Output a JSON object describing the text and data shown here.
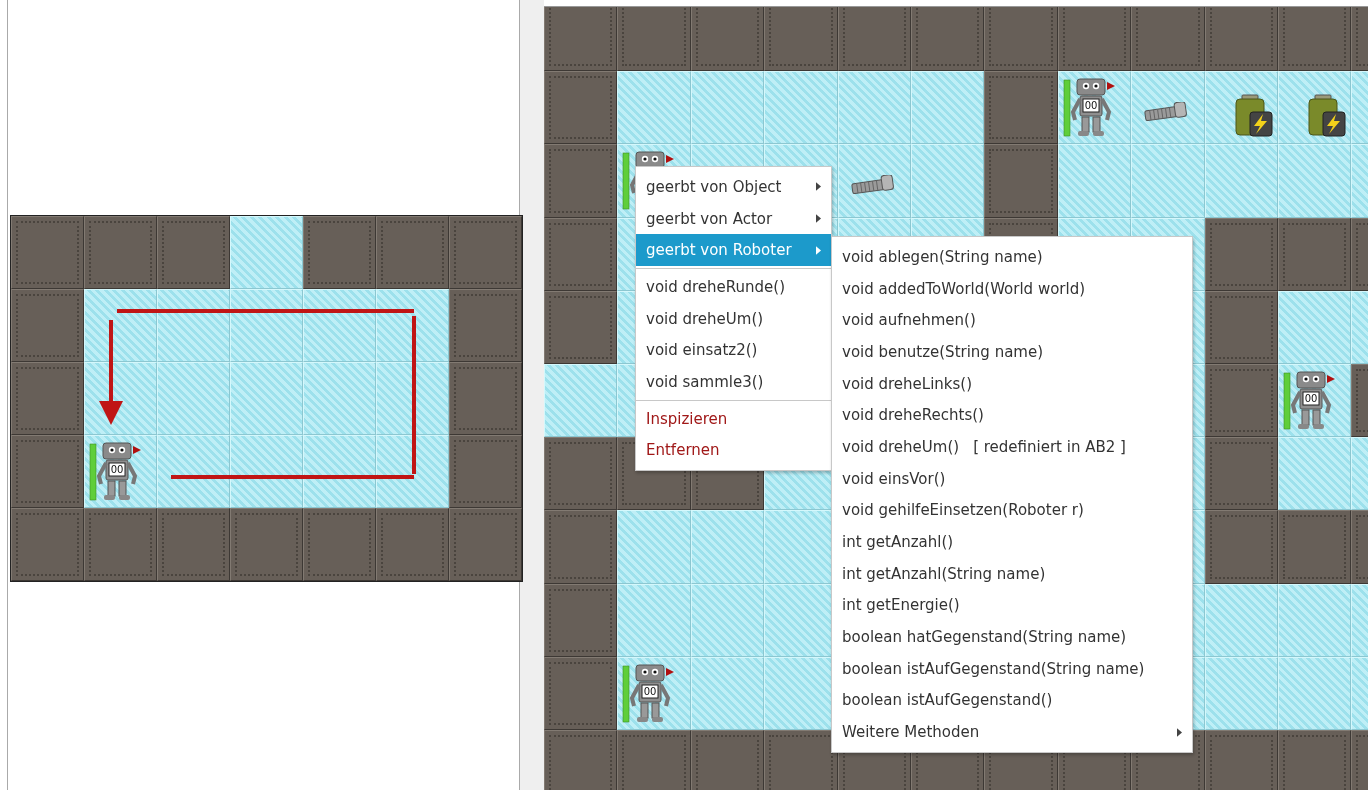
{
  "left_world": {
    "rows": [
      [
        {
          "kind": "wall"
        },
        {
          "kind": "wall"
        },
        {
          "kind": "wall"
        },
        {
          "kind": "floor"
        },
        {
          "kind": "wall"
        },
        {
          "kind": "wall"
        },
        {
          "kind": "wall"
        }
      ],
      [
        {
          "kind": "wall"
        },
        {
          "kind": "floor"
        },
        {
          "kind": "floor"
        },
        {
          "kind": "floor"
        },
        {
          "kind": "floor"
        },
        {
          "kind": "floor"
        },
        {
          "kind": "wall"
        }
      ],
      [
        {
          "kind": "wall"
        },
        {
          "kind": "floor"
        },
        {
          "kind": "floor"
        },
        {
          "kind": "floor"
        },
        {
          "kind": "floor"
        },
        {
          "kind": "floor"
        },
        {
          "kind": "wall"
        }
      ],
      [
        {
          "kind": "wall"
        },
        {
          "kind": "floor",
          "actor": {
            "kind": "robot",
            "counter": "00"
          }
        },
        {
          "kind": "floor"
        },
        {
          "kind": "floor"
        },
        {
          "kind": "floor"
        },
        {
          "kind": "floor"
        },
        {
          "kind": "wall"
        }
      ],
      [
        {
          "kind": "wall"
        },
        {
          "kind": "wall"
        },
        {
          "kind": "wall"
        },
        {
          "kind": "wall"
        },
        {
          "kind": "wall"
        },
        {
          "kind": "wall"
        },
        {
          "kind": "wall"
        }
      ]
    ]
  },
  "right_world": {
    "rows": [
      [
        {
          "kind": "wall"
        },
        {
          "kind": "wall"
        },
        {
          "kind": "wall"
        },
        {
          "kind": "wall"
        },
        {
          "kind": "wall"
        },
        {
          "kind": "wall"
        },
        {
          "kind": "wall"
        },
        {
          "kind": "wall"
        },
        {
          "kind": "wall"
        },
        {
          "kind": "wall"
        },
        {
          "kind": "wall"
        },
        {
          "kind": "wall"
        }
      ],
      [
        {
          "kind": "wall"
        },
        {
          "kind": "floor"
        },
        {
          "kind": "floor"
        },
        {
          "kind": "floor"
        },
        {
          "kind": "floor"
        },
        {
          "kind": "floor"
        },
        {
          "kind": "wall"
        },
        {
          "kind": "floor",
          "actor": {
            "kind": "robot",
            "counter": "00"
          }
        },
        {
          "kind": "floor",
          "actor": {
            "kind": "screw"
          }
        },
        {
          "kind": "floor",
          "actor": {
            "kind": "battery"
          }
        },
        {
          "kind": "floor",
          "actor": {
            "kind": "battery"
          }
        },
        {
          "kind": "floor"
        }
      ],
      [
        {
          "kind": "wall"
        },
        {
          "kind": "floor",
          "actor": {
            "kind": "robot"
          }
        },
        {
          "kind": "floor"
        },
        {
          "kind": "floor"
        },
        {
          "kind": "floor",
          "actor": {
            "kind": "screw"
          }
        },
        {
          "kind": "floor"
        },
        {
          "kind": "wall"
        },
        {
          "kind": "floor"
        },
        {
          "kind": "floor"
        },
        {
          "kind": "floor"
        },
        {
          "kind": "floor"
        },
        {
          "kind": "floor"
        }
      ],
      [
        {
          "kind": "wall"
        },
        {
          "kind": "floor"
        },
        {},
        {
          "kind": "floor"
        },
        {
          "kind": "floor"
        },
        {
          "kind": "floor"
        },
        {
          "kind": "wall"
        },
        {
          "kind": "floor"
        },
        {
          "kind": "floor"
        },
        {
          "kind": "wall"
        },
        {
          "kind": "wall"
        },
        {
          "kind": "wall"
        }
      ],
      [
        {
          "kind": "wall"
        },
        {
          "kind": "floor"
        },
        {},
        {},
        {},
        {},
        {},
        {},
        {
          "kind": "floor"
        },
        {
          "kind": "wall"
        },
        {
          "kind": "floor"
        },
        {
          "kind": "floor"
        }
      ],
      [
        {
          "kind": "floor"
        },
        {
          "kind": "floor"
        },
        {},
        {},
        {},
        {},
        {},
        {},
        {
          "kind": "floor"
        },
        {
          "kind": "wall"
        },
        {
          "kind": "floor",
          "actor": {
            "kind": "robot",
            "counter": "00"
          }
        },
        {
          "kind": "wall"
        }
      ],
      [
        {
          "kind": "wall"
        },
        {
          "kind": "wall"
        },
        {
          "kind": "wall"
        },
        {
          "kind": "floor"
        },
        {},
        {},
        {},
        {},
        {
          "kind": "floor"
        },
        {
          "kind": "wall"
        },
        {
          "kind": "floor"
        },
        {
          "kind": "floor"
        }
      ],
      [
        {
          "kind": "wall"
        },
        {
          "kind": "floor"
        },
        {
          "kind": "floor"
        },
        {
          "kind": "floor"
        },
        {},
        {},
        {},
        {},
        {
          "kind": "floor"
        },
        {
          "kind": "wall"
        },
        {
          "kind": "wall"
        },
        {
          "kind": "wall"
        }
      ],
      [
        {
          "kind": "wall"
        },
        {
          "kind": "floor"
        },
        {
          "kind": "floor"
        },
        {
          "kind": "floor"
        },
        {},
        {},
        {},
        {},
        {
          "kind": "floor"
        },
        {
          "kind": "floor"
        },
        {
          "kind": "floor"
        },
        {
          "kind": "floor"
        }
      ],
      [
        {
          "kind": "wall"
        },
        {
          "kind": "floor",
          "actor": {
            "kind": "robot",
            "counter": "00"
          }
        },
        {
          "kind": "floor"
        },
        {
          "kind": "floor"
        },
        {},
        {},
        {},
        {},
        {
          "kind": "floor"
        },
        {
          "kind": "floor"
        },
        {
          "kind": "floor"
        },
        {
          "kind": "floor"
        }
      ],
      [
        {
          "kind": "wall"
        },
        {
          "kind": "wall"
        },
        {
          "kind": "wall"
        },
        {
          "kind": "wall"
        },
        {
          "kind": "wall"
        },
        {
          "kind": "wall"
        },
        {
          "kind": "wall"
        },
        {
          "kind": "wall"
        },
        {
          "kind": "wall"
        },
        {
          "kind": "wall"
        },
        {
          "kind": "wall"
        },
        {
          "kind": "wall"
        }
      ]
    ]
  },
  "context_menu": {
    "groups": [
      [
        {
          "label": "geerbt von Object",
          "kind": "submenu",
          "selected": false
        },
        {
          "label": "geerbt von Actor",
          "kind": "submenu",
          "selected": false
        },
        {
          "label": "geerbt von Roboter",
          "kind": "submenu",
          "selected": true
        }
      ],
      [
        {
          "label": "void dreheRunde()",
          "kind": "method",
          "selected": false
        },
        {
          "label": "void dreheUm()",
          "kind": "method",
          "selected": false
        },
        {
          "label": "void einsatz2()",
          "kind": "method",
          "selected": false
        },
        {
          "label": "void sammle3()",
          "kind": "method",
          "selected": false
        }
      ],
      [
        {
          "label": "Inspizieren",
          "kind": "action",
          "selected": false
        },
        {
          "label": "Entfernen",
          "kind": "action",
          "selected": false
        }
      ]
    ]
  },
  "submenu": {
    "items": [
      {
        "label": "void ablegen(String name)",
        "kind": "method"
      },
      {
        "label": "void addedToWorld(World world)",
        "kind": "method"
      },
      {
        "label": "void aufnehmen()",
        "kind": "method"
      },
      {
        "label": "void benutze(String name)",
        "kind": "method"
      },
      {
        "label": "void dreheLinks()",
        "kind": "method"
      },
      {
        "label": "void dreheRechts()",
        "kind": "method"
      },
      {
        "label": "void dreheUm()",
        "kind": "method",
        "note": "[ redefiniert in AB2 ]"
      },
      {
        "label": "void einsVor()",
        "kind": "method"
      },
      {
        "label": "void gehilfeEinsetzen(Roboter r)",
        "kind": "method"
      },
      {
        "label": "int getAnzahl()",
        "kind": "method"
      },
      {
        "label": "int getAnzahl(String name)",
        "kind": "method"
      },
      {
        "label": "int getEnergie()",
        "kind": "method"
      },
      {
        "label": "boolean hatGegenstand(String name)",
        "kind": "method"
      },
      {
        "label": "boolean istAufGegenstand(String name)",
        "kind": "method"
      },
      {
        "label": "boolean istAufGegenstand()",
        "kind": "method"
      },
      {
        "label": "Weitere Methoden",
        "kind": "submenu"
      }
    ]
  }
}
